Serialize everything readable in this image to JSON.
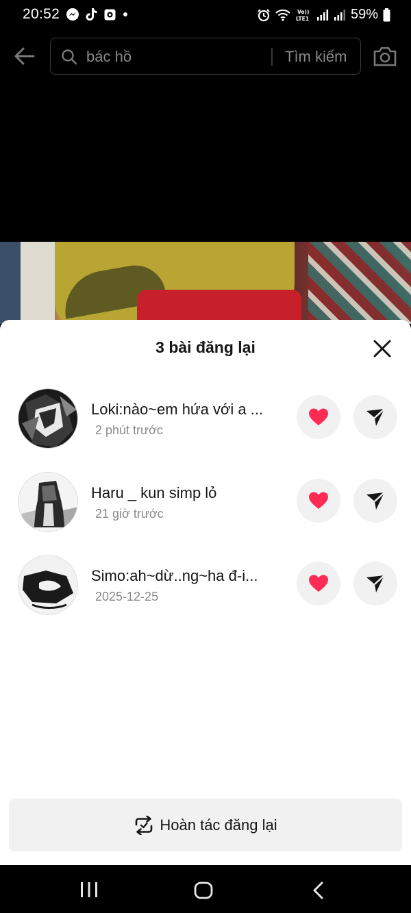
{
  "status_bar": {
    "time": "20:52",
    "battery": "59%",
    "app_icons": [
      "messenger-icon",
      "tiktok-icon",
      "gallery-icon",
      "dot-icon"
    ],
    "system_icons": [
      "alarm-icon",
      "wifi-icon",
      "volte-icon",
      "signal-icon",
      "signal-icon",
      "battery-icon"
    ]
  },
  "search": {
    "query": "bác hồ",
    "action_label": "Tìm kiếm"
  },
  "sheet": {
    "title": "3 bài đăng lại",
    "items": [
      {
        "name": "Loki:nào~em hứa với a ...",
        "time": "2 phút trước"
      },
      {
        "name": "Haru _ kun simp lỏ",
        "time": "21 giờ trước"
      },
      {
        "name": "Simo:ah~dừ..ng~ha đ-i...",
        "time": "2025-12-25"
      }
    ],
    "undo_label": "Hoàn tác đăng lại"
  },
  "colors": {
    "heart": "#fe2c55",
    "button_bg": "#f1f1f2",
    "muted_text": "#8a8a8a"
  }
}
